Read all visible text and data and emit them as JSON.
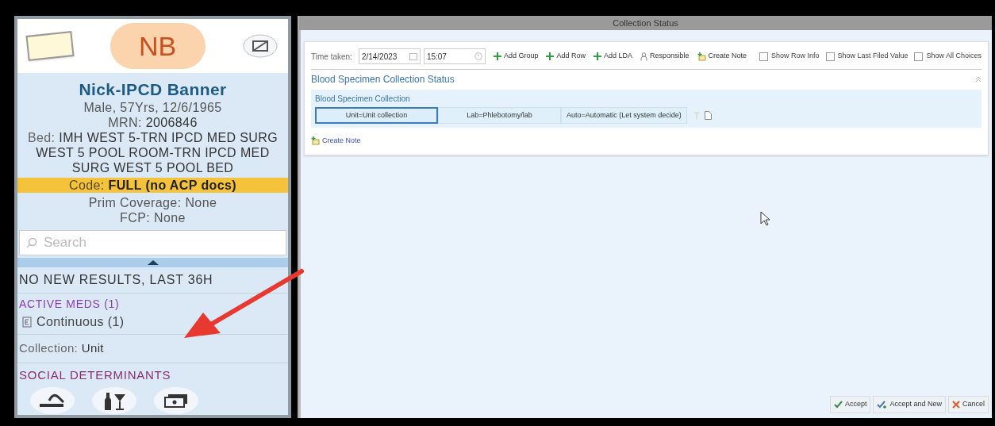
{
  "sidebar": {
    "initials": "NB",
    "patient_name": "Nick-IPCD Banner",
    "demographics": "Male, 57Yrs, 12/6/1965",
    "mrn_label": "MRN:",
    "mrn": "2006846",
    "bed_label": "Bed:",
    "bed": "IMH WEST 5-TRN IPCD MED SURG WEST 5 POOL ROOM-TRN IPCD MED SURG WEST 5 POOL BED",
    "code_label": "Code:",
    "code": "FULL (no ACP docs)",
    "coverage_label": "Prim Coverage:",
    "coverage": "None",
    "fcp_label": "FCP:",
    "fcp": "None",
    "search": {
      "placeholder": "Search"
    },
    "results": "NO NEW RESULTS, LAST 36H",
    "meds_heading": "ACTIVE MEDS (1)",
    "meds_item": "Continuous (1)",
    "collection_label": "Collection:",
    "collection": "Unit",
    "social_heading": "SOCIAL DETERMINANTS"
  },
  "window": {
    "title": "Collection Status"
  },
  "toolbar": {
    "time_label": "Time taken:",
    "date": "2/14/2023",
    "time": "15:07",
    "actions": [
      {
        "kind": "add",
        "label": "Add Group"
      },
      {
        "kind": "add",
        "label": "Add Row"
      },
      {
        "kind": "add",
        "label": "Add LDA"
      },
      {
        "kind": "person",
        "label": "Responsible"
      },
      {
        "kind": "note",
        "label": "Create Note"
      }
    ],
    "checkboxes": [
      {
        "label": "Show Row Info",
        "checked": false
      },
      {
        "label": "Show Last Filed Value",
        "checked": false
      },
      {
        "label": "Show All Choices",
        "checked": false
      }
    ]
  },
  "section": {
    "title": "Blood Specimen Collection Status",
    "group": "Blood Specimen Collection",
    "options": [
      {
        "label": "Unit=Unit collection",
        "selected": true
      },
      {
        "label": "Lab=Phlebotomy/lab",
        "selected": false
      },
      {
        "label": "Auto=Automatic (Let system decide)",
        "selected": false
      }
    ],
    "note_link": "Create Note"
  },
  "footer": [
    {
      "kind": "accept",
      "label": "Accept"
    },
    {
      "kind": "accept_new",
      "label": "Accept and New"
    },
    {
      "kind": "cancel",
      "label": "Cancel"
    }
  ]
}
